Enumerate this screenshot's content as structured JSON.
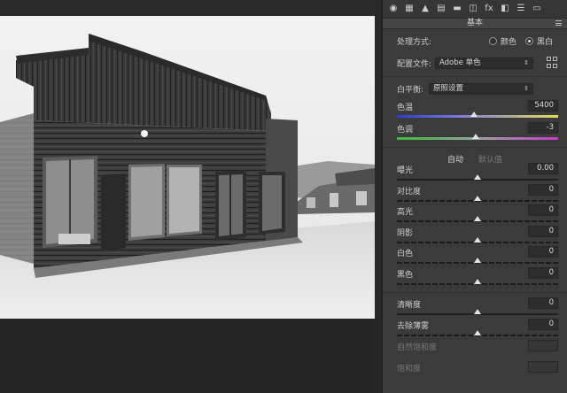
{
  "tabs": [
    {
      "name": "basic-tab-icon",
      "glyph": "◉"
    },
    {
      "name": "tone-curve-tab-icon",
      "glyph": "▦"
    },
    {
      "name": "detail-tab-icon",
      "glyph": "▲"
    },
    {
      "name": "hsl-tab-icon",
      "glyph": "▤"
    },
    {
      "name": "split-toning-tab-icon",
      "glyph": "▬"
    },
    {
      "name": "lens-tab-icon",
      "glyph": "◫"
    },
    {
      "name": "fx-tab-icon",
      "glyph": "fx"
    },
    {
      "name": "calibration-tab-icon",
      "glyph": "◧"
    },
    {
      "name": "presets-tab-icon",
      "glyph": "☰"
    },
    {
      "name": "snapshots-tab-icon",
      "glyph": "▭"
    }
  ],
  "section": {
    "title": "基本"
  },
  "treatment": {
    "label": "处理方式:",
    "option_color": "颜色",
    "option_bw": "黑白",
    "selected": "黑白"
  },
  "profile": {
    "label": "配置文件:",
    "value": "Adobe 单色"
  },
  "white_balance": {
    "label": "白平衡:",
    "value": "原照设置"
  },
  "temperature": {
    "label": "色温",
    "value": "5400",
    "level": 0.48
  },
  "tint": {
    "label": "色调",
    "value": "-3",
    "level": 0.49
  },
  "auto": {
    "auto_label": "自动",
    "default_label": "默认值"
  },
  "sliders": [
    {
      "label": "曝光",
      "value": "0.00",
      "level": 0.5
    },
    {
      "label": "对比度",
      "value": "0",
      "level": 0.5
    },
    {
      "label": "高光",
      "value": "0",
      "level": 0.5
    },
    {
      "label": "阴影",
      "value": "0",
      "level": 0.5
    },
    {
      "label": "白色",
      "value": "0",
      "level": 0.5
    },
    {
      "label": "黑色",
      "value": "0",
      "level": 0.5
    }
  ],
  "presence": [
    {
      "label": "清晰度",
      "value": "0",
      "level": 0.5,
      "dim": false
    },
    {
      "label": "去除薄雾",
      "value": "0",
      "level": 0.5,
      "dim": false
    },
    {
      "label": "自然饱和度",
      "value": "",
      "level": 0.5,
      "dim": true
    },
    {
      "label": "饱和度",
      "value": "",
      "level": 0.5,
      "dim": true
    }
  ]
}
